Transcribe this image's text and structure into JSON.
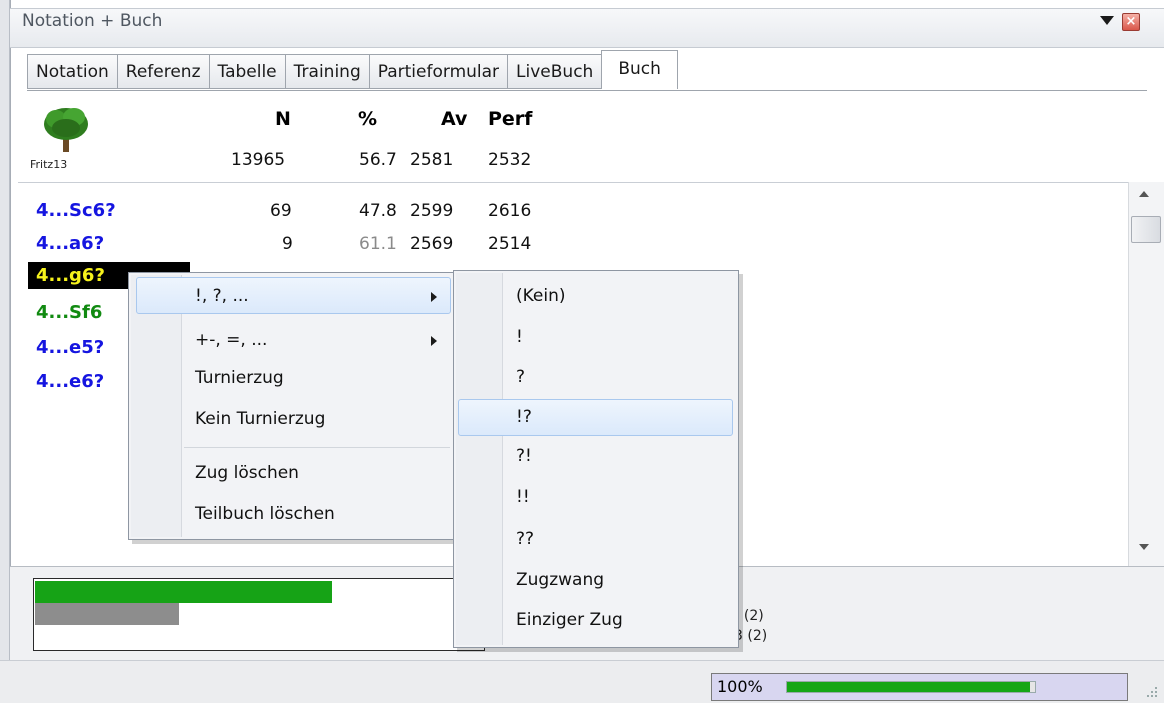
{
  "panel": {
    "title": "Notation + Buch"
  },
  "tabs": [
    {
      "label": "Notation"
    },
    {
      "label": "Referenz"
    },
    {
      "label": "Tabelle"
    },
    {
      "label": "Training"
    },
    {
      "label": "Partieformular"
    },
    {
      "label": "LiveBuch"
    },
    {
      "label": "Buch",
      "active": true
    }
  ],
  "book": {
    "tree_label": "Fritz13",
    "headers": {
      "n": "N",
      "pct": "%",
      "av": "Av",
      "perf": "Perf"
    },
    "totals": {
      "n": "13965",
      "pct": "56.7",
      "av": "2581",
      "perf": "2532"
    },
    "rows": [
      {
        "move": "4...Sc6?",
        "n": "69",
        "pct": "47.8",
        "av": "2599",
        "perf": "2616",
        "color": "#1515e0"
      },
      {
        "move": "4...a6?",
        "n": "9",
        "pct": "61.1",
        "av": "2569",
        "perf": "2514",
        "color": "#1515e0"
      },
      {
        "move": "4...g6?",
        "color": "#f6f21c",
        "selected": true
      },
      {
        "move": "4...Sf6",
        "color": "#118a11"
      },
      {
        "move": "4...e5?",
        "color": "#1515e0"
      },
      {
        "move": "4...e6?",
        "color": "#1515e0"
      }
    ]
  },
  "bars": {
    "green_fraction": 0.66,
    "gray_fraction": 0.32,
    "tail1": ") (2)",
    "tail2": "3 (2)"
  },
  "context_menu": {
    "items": [
      "!, ?, ...",
      "+-, =, ...",
      "Turnierzug",
      "Kein Turnierzug",
      "Zug löschen",
      "Teilbuch löschen"
    ],
    "highlighted": "!, ?, ..."
  },
  "submenu": {
    "items": [
      "(Kein)",
      "!",
      "?",
      "!?",
      "?!",
      "!!",
      "??",
      "Zugzwang",
      "Einziger Zug"
    ],
    "highlighted": "!?"
  },
  "status": {
    "zoom_label": "100%",
    "zoom_progress": 0.98
  },
  "colors": {
    "accent_green": "#16a316",
    "highlight": "#dbe9fb",
    "move_blue": "#1515e0"
  }
}
